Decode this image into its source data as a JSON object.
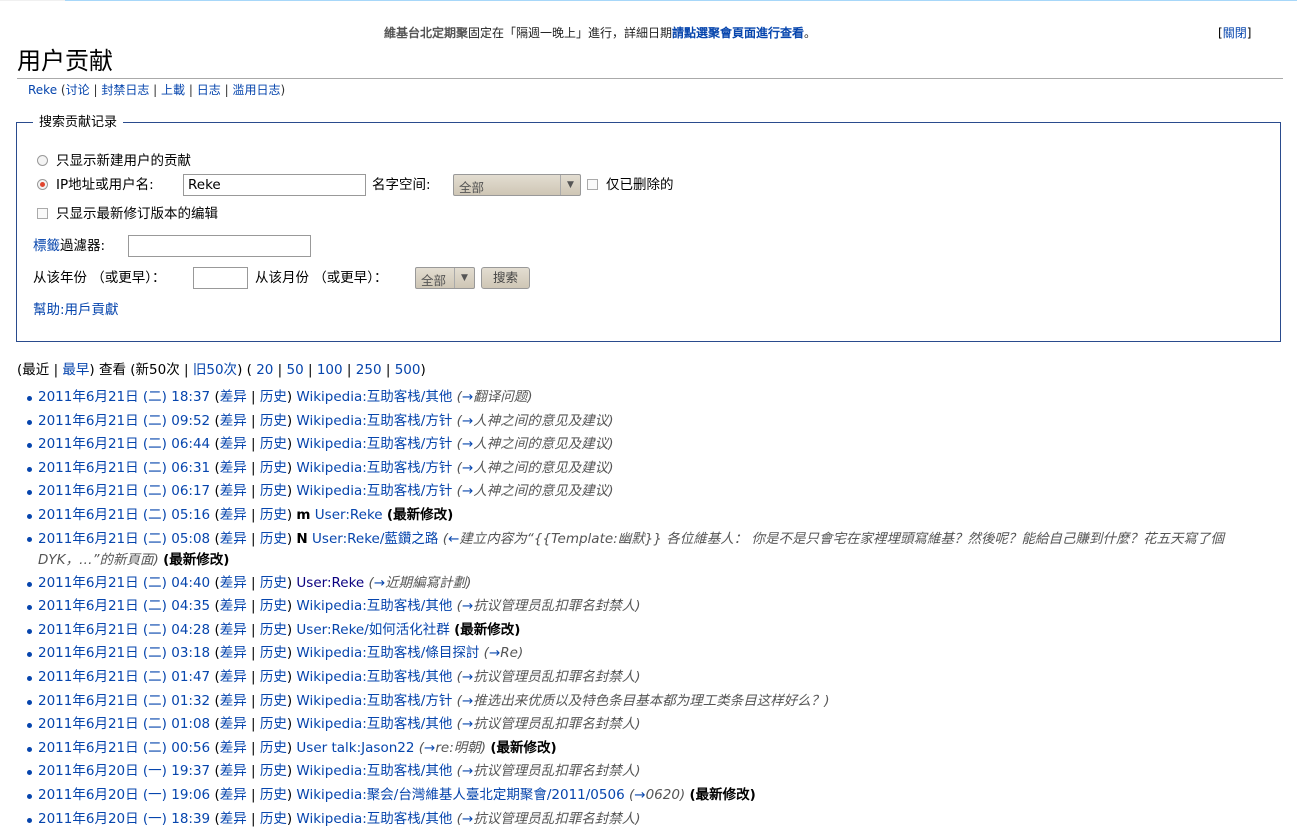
{
  "sitenotice": {
    "part1": "維基台北定期聚",
    "part2": "固定在「隔週一晚上」進行，詳細日期",
    "part3": "請點選聚會頁面進行查看",
    "part4": "。",
    "dismiss_open": "[",
    "dismiss_label": "關閉",
    "dismiss_close": "]"
  },
  "page_title": "用户贡献",
  "subtitle": {
    "user": "Reke",
    "talk": "讨论",
    "block_log": "封禁日志",
    "upload": "上載",
    "log": "日志",
    "abuse_log": "滥用日志"
  },
  "search_form": {
    "legend": "搜索贡献记录",
    "new_users_only": "只显示新建用户的贡献",
    "ip_or_user_label": "IP地址或用户名:",
    "ip_or_user_value": "Reke",
    "namespace_label": "名字空间:",
    "namespace_value": "全部",
    "deleted_only": "仅已删除的",
    "latest_only": "只显示最新修订版本的编辑",
    "tag_filter_link": "標籤",
    "tag_filter_label": "過濾器:",
    "tag_filter_value": "",
    "year_label": "从该年份 （或更早）：",
    "year_value": "",
    "month_label": "从该月份 （或更早）：",
    "month_value": "全部",
    "search_button": "搜索",
    "help_link": "幫助:用戶貢獻"
  },
  "nav": {
    "open": "(",
    "latest": "最近",
    "earliest": "最早",
    "view": ") 查看 (",
    "newer": "新50次",
    "older": "旧50次",
    "close_mid": ") (",
    "limits": [
      "20",
      "50",
      "100",
      "250",
      "500"
    ],
    "close": ")"
  },
  "labels": {
    "diff": "差异",
    "hist": "历史",
    "latest": "(最新修改)"
  },
  "contributions": [
    {
      "date": "2011年6月21日 (二) 18:37",
      "flag": "",
      "page": "Wikipedia:互助客栈/其他",
      "comment": "翻译问题",
      "latest": false
    },
    {
      "date": "2011年6月21日 (二) 09:52",
      "flag": "",
      "page": "Wikipedia:互助客栈/方针",
      "comment": "人神之间的意见及建议",
      "latest": false
    },
    {
      "date": "2011年6月21日 (二) 06:44",
      "flag": "",
      "page": "Wikipedia:互助客栈/方针",
      "comment": "人神之间的意见及建议",
      "latest": false
    },
    {
      "date": "2011年6月21日 (二) 06:31",
      "flag": "",
      "page": "Wikipedia:互助客栈/方针",
      "comment": "人神之间的意见及建议",
      "latest": false
    },
    {
      "date": "2011年6月21日 (二) 06:17",
      "flag": "",
      "page": "Wikipedia:互助客栈/方针",
      "comment": "人神之间的意见及建议",
      "latest": false
    },
    {
      "date": "2011年6月21日 (二) 05:16",
      "flag": "m",
      "page": "User:Reke",
      "comment": "",
      "latest": true
    },
    {
      "date": "2011年6月21日 (二) 05:08",
      "flag": "N",
      "page": "User:Reke/藍鑽之路",
      "comment": "建立内容为“{{Template:幽默}} 各位維基人： 你是不是只會宅在家裡埋頭寫維基？然後呢？能給自己賺到什麼？花五天寫了個DYK，…”的新頁面",
      "latest": true,
      "wrap": true
    },
    {
      "date": "2011年6月21日 (二) 04:40",
      "flag": "",
      "page": "User:Reke",
      "comment": "近期編寫計劃",
      "latest": false,
      "visited": true
    },
    {
      "date": "2011年6月21日 (二) 04:35",
      "flag": "",
      "page": "Wikipedia:互助客栈/其他",
      "comment": "抗议管理员乱扣罪名封禁人",
      "latest": false
    },
    {
      "date": "2011年6月21日 (二) 04:28",
      "flag": "",
      "page": "User:Reke/如何活化社群",
      "comment": "",
      "latest": true
    },
    {
      "date": "2011年6月21日 (二) 03:18",
      "flag": "",
      "page": "Wikipedia:互助客栈/條目探討",
      "comment": "Re",
      "latest": false
    },
    {
      "date": "2011年6月21日 (二) 01:47",
      "flag": "",
      "page": "Wikipedia:互助客栈/其他",
      "comment": "抗议管理员乱扣罪名封禁人",
      "latest": false
    },
    {
      "date": "2011年6月21日 (二) 01:32",
      "flag": "",
      "page": "Wikipedia:互助客栈/方针",
      "comment": "推选出来优质以及特色条目基本都为理工类条目这样好么？",
      "latest": false
    },
    {
      "date": "2011年6月21日 (二) 01:08",
      "flag": "",
      "page": "Wikipedia:互助客栈/其他",
      "comment": "抗议管理员乱扣罪名封禁人",
      "latest": false
    },
    {
      "date": "2011年6月21日 (二) 00:56",
      "flag": "",
      "page": "User talk:Jason22",
      "comment": "re:明朝",
      "latest": true
    },
    {
      "date": "2011年6月20日 (一) 19:37",
      "flag": "",
      "page": "Wikipedia:互助客栈/其他",
      "comment": "抗议管理员乱扣罪名封禁人",
      "latest": false
    },
    {
      "date": "2011年6月20日 (一) 19:06",
      "flag": "",
      "page": "Wikipedia:聚会/台灣維基人臺北定期聚會/2011/0506",
      "comment": "0620",
      "latest": true
    },
    {
      "date": "2011年6月20日 (一) 18:39",
      "flag": "",
      "page": "Wikipedia:互助客栈/其他",
      "comment": "抗议管理员乱扣罪名封禁人",
      "latest": false
    }
  ]
}
